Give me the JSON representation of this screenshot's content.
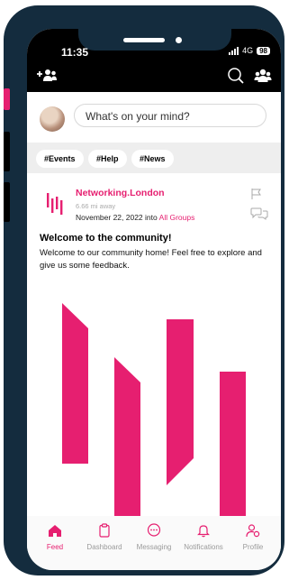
{
  "status_bar": {
    "time": "11:35",
    "network": "4G",
    "battery": "98"
  },
  "header": {
    "icons": [
      "add-user-icon",
      "search-icon",
      "groups-icon"
    ]
  },
  "composer": {
    "placeholder": "What's on your mind?"
  },
  "tags": [
    "#Events",
    "#Help",
    "#News"
  ],
  "post": {
    "author": "Networking.London",
    "distance": "6.66 mi away",
    "date": "November 22, 2022",
    "into_word": "into",
    "group": "All Groups",
    "title": "Welcome to the community!",
    "body": "Welcome to our community home! Feel free to explore and give us some feedback."
  },
  "tabs": [
    {
      "label": "Feed",
      "icon": "home-icon",
      "active": true
    },
    {
      "label": "Dashboard",
      "icon": "clipboard-icon",
      "active": false
    },
    {
      "label": "Messaging",
      "icon": "chat-bubble-icon",
      "active": false
    },
    {
      "label": "Notifications",
      "icon": "bell-icon",
      "active": false
    },
    {
      "label": "Profile",
      "icon": "profile-settings-icon",
      "active": false
    }
  ],
  "colors": {
    "brand": "#e61f70",
    "frame": "#142c3e",
    "header": "#000000"
  }
}
